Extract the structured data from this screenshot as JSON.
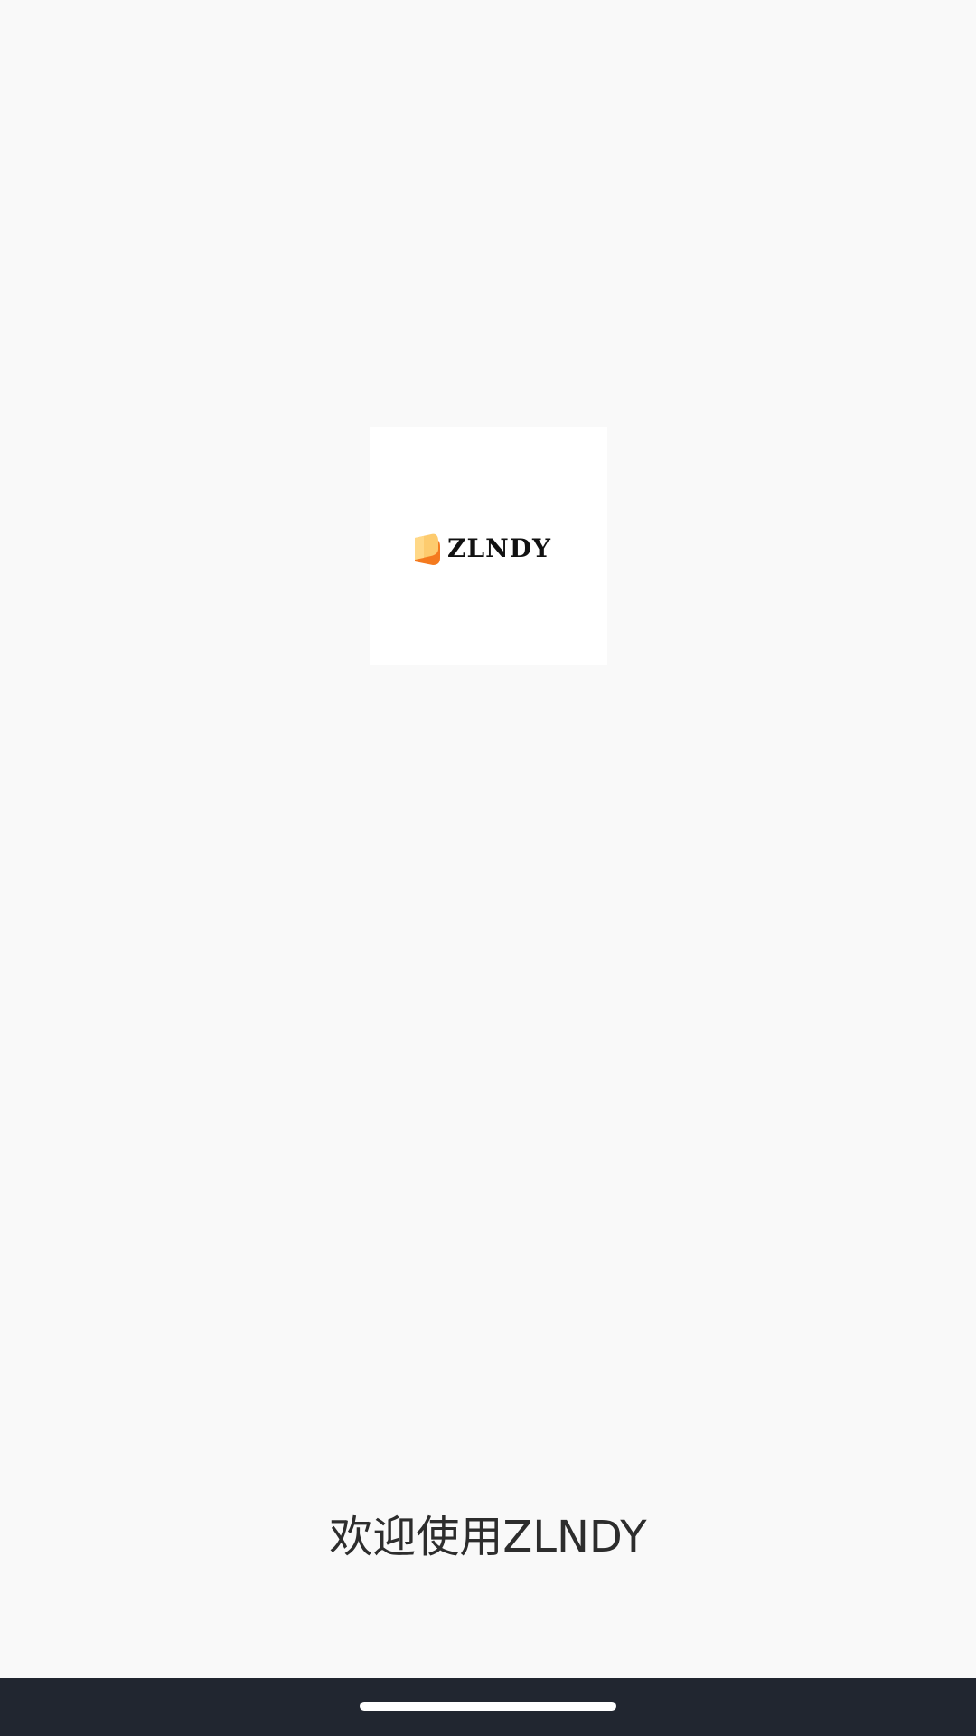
{
  "splash": {
    "logo_text": "ZLNDY",
    "welcome_text": "欢迎使用ZLNDY"
  },
  "icons": {
    "logo_mark": "book-logo-icon"
  },
  "colors": {
    "background": "#F9F9F9",
    "logo_card": "#FFFFFF",
    "logo_orange": "#F47A1F",
    "logo_yellow": "#FDCB6E",
    "text": "#2D2D2D",
    "nav_bar": "#212630"
  }
}
